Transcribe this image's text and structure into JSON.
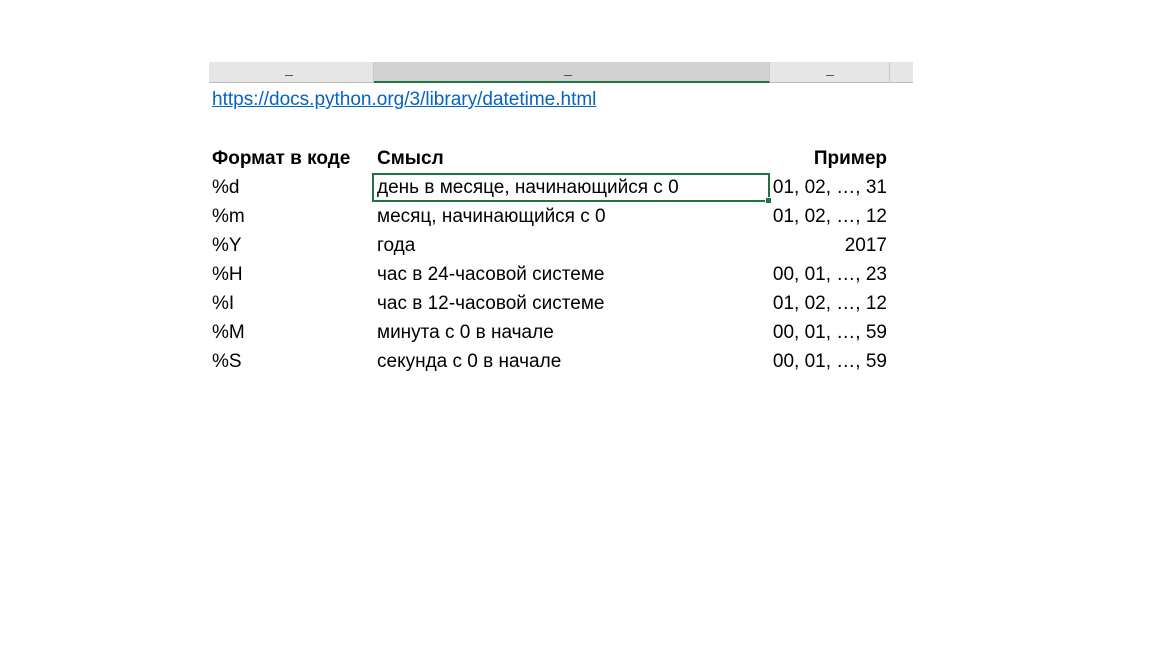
{
  "sheet": {
    "link": "https://docs.python.org/3/library/datetime.html",
    "table": {
      "headers": [
        "Формат в коде",
        "Смысл",
        "Пример"
      ],
      "rows": [
        [
          "%d",
          "день в месяце, начинающийся с 0",
          "01, 02, …, 31"
        ],
        [
          "%m",
          "месяц, начинающийся с 0",
          "01, 02, …, 12"
        ],
        [
          "%Y",
          "года",
          "2017"
        ],
        [
          "%H",
          "час в 24-часовой системе",
          "00, 01, …, 23"
        ],
        [
          "%I",
          "час в 12-часовой системе",
          "01, 02, …, 12"
        ],
        [
          "%M",
          "минута с 0 в начале",
          "00, 01, …, 59"
        ],
        [
          "%S",
          "секунда с 0 в начале",
          "00, 01, …, 59"
        ]
      ]
    },
    "selected_cell": "B row 1",
    "colors": {
      "link": "#0563c1",
      "selection": "#217346",
      "header_bg": "#e6e6e6"
    }
  }
}
